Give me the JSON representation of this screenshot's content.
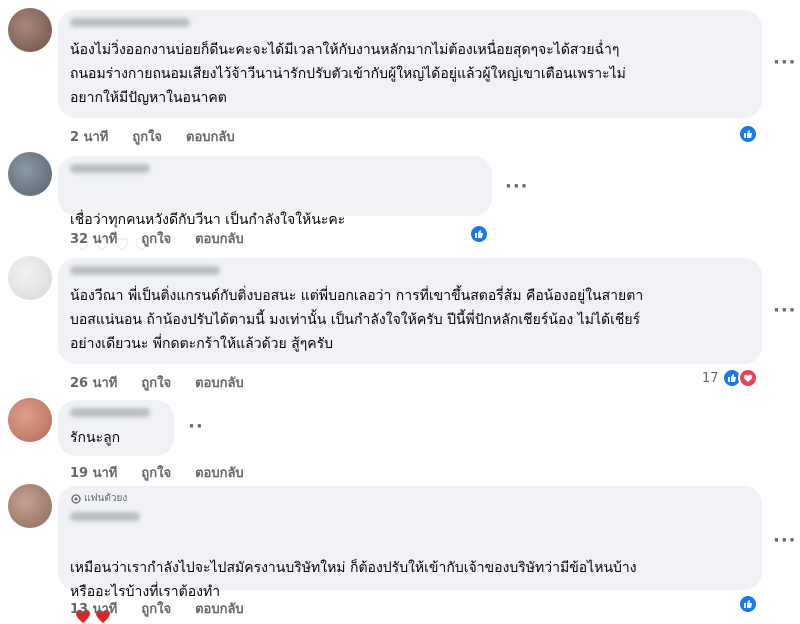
{
  "comments": [
    {
      "text": "น้องไม่วิ่งออกงานบ่อยก็ดีนะคะจะได้มีเวลาให้กับงานหลักมากไม่ต้องเหนื่อยสุดๆจะได้สวยฉ่ำๆ\nถนอมร่างกายถนอมเสียงไว้จ้าวีนาน่ารักปรับตัวเข้ากับผู้ใหญ่ได้อยู่แล้วผู้ใหญ่เขาเตือนเพราะไม่\nอยากให้มีปัญหาในอนาคต",
      "time": "2 นาที",
      "like": "ถูกใจ",
      "reply": "ตอบกลับ"
    },
    {
      "text": "เชื่อว่าทุกคนหวังดีกับวีนา เป็นกำลังใจให้นะคะ",
      "time": "32 นาที",
      "like": "ถูกใจ",
      "reply": "ตอบกลับ"
    },
    {
      "text": "น้องวีณา พี่เป็นติ่งแกรนด์กับติ่งบอสนะ แต่พี่บอกเลอว่า การที่เขาขึ้นสตอรี่ส้ม คือน้องอยู่ในสายตา\nบอสแน่นอน ถ้าน้องปรับได้ตามนี้ มงเท่านั้น เป็นกำลังใจให้ครับ ปีนี้พี่ปักหลักเชียร์น้อง ไม่ได้เชียร์\nอย่างเดียวนะ พี่กดตะกร้าให้แล้วด้วย สู้ๆครับ",
      "time": "26 นาที",
      "like": "ถูกใจ",
      "reply": "ตอบกลับ",
      "reaction_count": "17"
    },
    {
      "text": "รักนะลูก",
      "time": "19 นาที",
      "like": "ถูกใจ",
      "reply": "ตอบกลับ"
    },
    {
      "badge": "แฟนตัวยง",
      "text": "เหมือนว่าเรากำลังไปจะไปสมัครงานบริษัทใหม่ ก็ต้องปรับให้เข้ากับเจ้าของบริษัทว่ามีข้อไหนบ้าง\nหรืออะไรบ้างที่เราต้องทำ",
      "time": "13 นาที",
      "like": "ถูกใจ",
      "reply": "ตอบกลับ"
    }
  ],
  "icons": {
    "like": "thumbs-up-icon",
    "love": "heart-icon",
    "more": "more-options-icon"
  },
  "colors": {
    "like_blue": "#1877f2",
    "love_red": "#f33e58",
    "bubble": "#f0f2f5",
    "meta_text": "#65676b"
  }
}
